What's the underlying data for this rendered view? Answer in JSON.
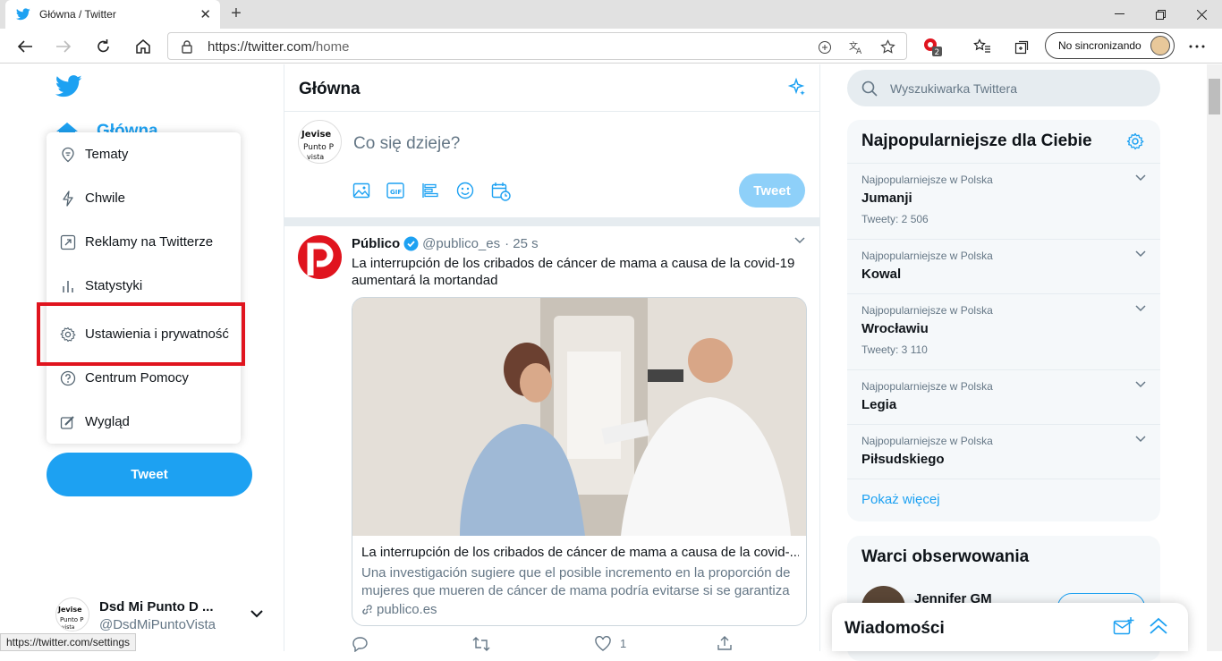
{
  "browser": {
    "tab_title": "Główna / Twitter",
    "url_prefix": "https://twitter.com",
    "url_path": "/home",
    "sync_label": "No sincronizando",
    "extension_badge": "2",
    "status_url": "https://twitter.com/settings"
  },
  "sidebar": {
    "home_label": "Główna",
    "menu": [
      {
        "label": "Tematy",
        "icon": "topics-icon"
      },
      {
        "label": "Chwile",
        "icon": "lightning-icon"
      },
      {
        "label": "Reklamy na Twitterze",
        "icon": "external-link-icon"
      },
      {
        "label": "Statystyki",
        "icon": "stats-icon"
      },
      {
        "label": "Ustawienia i prywatność",
        "icon": "gear-icon"
      },
      {
        "label": "Centrum Pomocy",
        "icon": "help-icon"
      },
      {
        "label": "Wygląd",
        "icon": "appearance-icon"
      }
    ],
    "tweet_button": "Tweet",
    "account": {
      "name": "Dsd Mi Punto D ...",
      "handle": "@DsdMiPuntoVista"
    }
  },
  "main": {
    "title": "Główna",
    "compose_placeholder": "Co się dzieje?",
    "compose_button": "Tweet",
    "tweet": {
      "author": "Público",
      "handle": "@publico_es",
      "time": "· 25 s",
      "text": "La interrupción de los cribados de cáncer de mama a causa de la covid-19 aumentará la mortandad",
      "card_title": "La interrupción de los cribados de cáncer de mama a causa de la covid-...",
      "card_desc": "Una investigación sugiere que el posible incremento en la proporción de mujeres que mueren de cáncer de mama podría evitarse si se garantiza ...",
      "card_domain": "publico.es",
      "like_count": "1"
    }
  },
  "right": {
    "search_placeholder": "Wyszukiwarka Twittera",
    "trends_title": "Najpopularniejsze dla Ciebie",
    "trends": [
      {
        "meta": "Najpopularniejsze w Polska",
        "name": "Jumanji",
        "count": "Tweety: 2 506"
      },
      {
        "meta": "Najpopularniejsze w Polska",
        "name": "Kowal",
        "count": ""
      },
      {
        "meta": "Najpopularniejsze w Polska",
        "name": "Wrocławiu",
        "count": "Tweety: 3 110"
      },
      {
        "meta": "Najpopularniejsze w Polska",
        "name": "Legia",
        "count": ""
      },
      {
        "meta": "Najpopularniejsze w Polska",
        "name": "Piłsudskiego",
        "count": ""
      }
    ],
    "show_more": "Pokaż więcej",
    "follow_title": "Warci obserwowania",
    "follow_name": "Jennifer GM",
    "messages_title": "Wiadomości"
  },
  "colors": {
    "accent": "#1da1f2",
    "highlight": "#e0141e"
  }
}
